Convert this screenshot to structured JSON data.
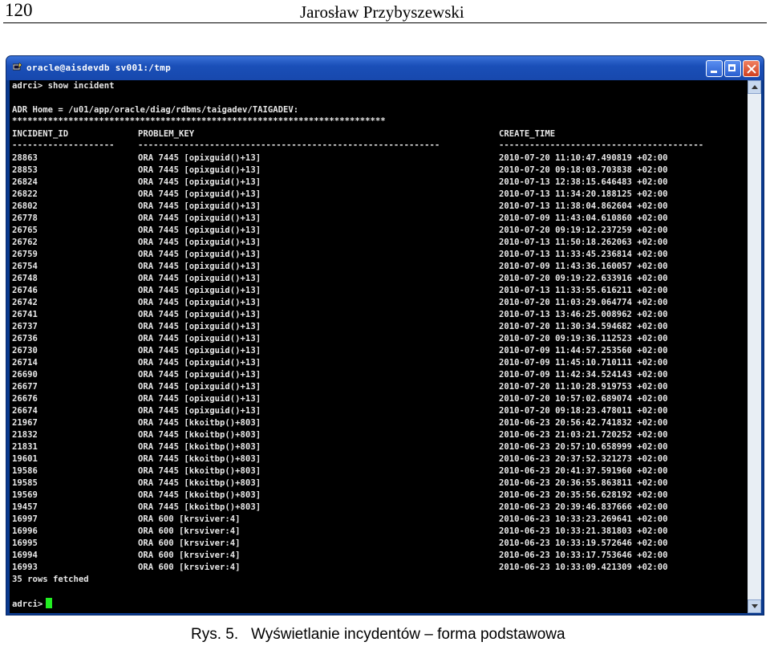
{
  "page": {
    "number": "120",
    "author": "Jarosław Przybyszewski",
    "caption_label": "Rys. 5.",
    "caption_text": "Wyświetlanie incydentów – forma podstawowa"
  },
  "window": {
    "title": "oracle@aisdevdb sv001:/tmp",
    "icon": "putty-icon",
    "buttons": [
      "minimize",
      "maximize",
      "close"
    ]
  },
  "terminal": {
    "command_line": "adrci> show incident",
    "adr_home": "ADR Home = /u01/app/oracle/diag/rdbms/taigadev/TAIGADEV:",
    "stars": "*************************************************************************",
    "headers": {
      "incident_id": "INCIDENT_ID",
      "problem_key": "PROBLEM_KEY",
      "create_time": "CREATE_TIME"
    },
    "separator_id": "--------------------",
    "separator_pk": "-----------------------------------------------------------",
    "separator_ct": "----------------------------------------",
    "rows": [
      [
        "28863",
        "ORA 7445 [opixguid()+13]",
        "2010-07-20 11:10:47.490819 +02:00"
      ],
      [
        "28853",
        "ORA 7445 [opixguid()+13]",
        "2010-07-20 09:18:03.703838 +02:00"
      ],
      [
        "26824",
        "ORA 7445 [opixguid()+13]",
        "2010-07-13 12:38:15.646483 +02:00"
      ],
      [
        "26822",
        "ORA 7445 [opixguid()+13]",
        "2010-07-13 11:34:20.188125 +02:00"
      ],
      [
        "26802",
        "ORA 7445 [opixguid()+13]",
        "2010-07-13 11:38:04.862604 +02:00"
      ],
      [
        "26778",
        "ORA 7445 [opixguid()+13]",
        "2010-07-09 11:43:04.610860 +02:00"
      ],
      [
        "26765",
        "ORA 7445 [opixguid()+13]",
        "2010-07-20 09:19:12.237259 +02:00"
      ],
      [
        "26762",
        "ORA 7445 [opixguid()+13]",
        "2010-07-13 11:50:18.262063 +02:00"
      ],
      [
        "26759",
        "ORA 7445 [opixguid()+13]",
        "2010-07-13 11:33:45.236814 +02:00"
      ],
      [
        "26754",
        "ORA 7445 [opixguid()+13]",
        "2010-07-09 11:43:36.160057 +02:00"
      ],
      [
        "26748",
        "ORA 7445 [opixguid()+13]",
        "2010-07-20 09:19:22.633916 +02:00"
      ],
      [
        "26746",
        "ORA 7445 [opixguid()+13]",
        "2010-07-13 11:33:55.616211 +02:00"
      ],
      [
        "26742",
        "ORA 7445 [opixguid()+13]",
        "2010-07-20 11:03:29.064774 +02:00"
      ],
      [
        "26741",
        "ORA 7445 [opixguid()+13]",
        "2010-07-13 13:46:25.008962 +02:00"
      ],
      [
        "26737",
        "ORA 7445 [opixguid()+13]",
        "2010-07-20 11:30:34.594682 +02:00"
      ],
      [
        "26736",
        "ORA 7445 [opixguid()+13]",
        "2010-07-20 09:19:36.112523 +02:00"
      ],
      [
        "26730",
        "ORA 7445 [opixguid()+13]",
        "2010-07-09 11:44:57.253560 +02:00"
      ],
      [
        "26714",
        "ORA 7445 [opixguid()+13]",
        "2010-07-09 11:45:10.710111 +02:00"
      ],
      [
        "26690",
        "ORA 7445 [opixguid()+13]",
        "2010-07-09 11:42:34.524143 +02:00"
      ],
      [
        "26677",
        "ORA 7445 [opixguid()+13]",
        "2010-07-20 11:10:28.919753 +02:00"
      ],
      [
        "26676",
        "ORA 7445 [opixguid()+13]",
        "2010-07-20 10:57:02.689074 +02:00"
      ],
      [
        "26674",
        "ORA 7445 [opixguid()+13]",
        "2010-07-20 09:18:23.478011 +02:00"
      ],
      [
        "21967",
        "ORA 7445 [kkoitbp()+803]",
        "2010-06-23 20:56:42.741832 +02:00"
      ],
      [
        "21832",
        "ORA 7445 [kkoitbp()+803]",
        "2010-06-23 21:03:21.720252 +02:00"
      ],
      [
        "21831",
        "ORA 7445 [kkoitbp()+803]",
        "2010-06-23 20:57:10.658999 +02:00"
      ],
      [
        "19601",
        "ORA 7445 [kkoitbp()+803]",
        "2010-06-23 20:37:52.321273 +02:00"
      ],
      [
        "19586",
        "ORA 7445 [kkoitbp()+803]",
        "2010-06-23 20:41:37.591960 +02:00"
      ],
      [
        "19585",
        "ORA 7445 [kkoitbp()+803]",
        "2010-06-23 20:36:55.863811 +02:00"
      ],
      [
        "19569",
        "ORA 7445 [kkoitbp()+803]",
        "2010-06-23 20:35:56.628192 +02:00"
      ],
      [
        "19457",
        "ORA 7445 [kkoitbp()+803]",
        "2010-06-23 20:39:46.837666 +02:00"
      ],
      [
        "16997",
        "ORA 600 [krsviver:4]",
        "2010-06-23 10:33:23.269641 +02:00"
      ],
      [
        "16996",
        "ORA 600 [krsviver:4]",
        "2010-06-23 10:33:21.381803 +02:00"
      ],
      [
        "16995",
        "ORA 600 [krsviver:4]",
        "2010-06-23 10:33:19.572646 +02:00"
      ],
      [
        "16994",
        "ORA 600 [krsviver:4]",
        "2010-06-23 10:33:17.753646 +02:00"
      ],
      [
        "16993",
        "ORA 600 [krsviver:4]",
        "2010-06-23 10:33:09.421309 +02:00"
      ]
    ],
    "footer": "35 rows fetched",
    "prompt": "adrci>",
    "colors": {
      "background": "#000000",
      "text": "#e8e8e8",
      "cursor": "#22ee22"
    }
  }
}
